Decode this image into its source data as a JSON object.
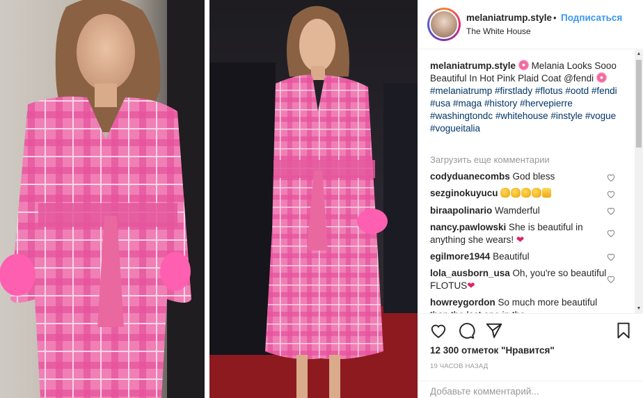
{
  "header": {
    "username": "melaniatrump.style",
    "separator": "•",
    "follow_label": "Подписаться",
    "location": "The White House"
  },
  "caption": {
    "username": "melaniatrump.style",
    "text": " Melania Looks Sooo Beautiful In Hot Pink Plaid Coat @fendi ",
    "hashtags": "#melaniatrump #firstlady #flotus #ootd #fendi #usa #maga #history #hervepierre #washingtondc #whitehouse #instyle #vogue #vogueitalia"
  },
  "load_more_label": "Загрузить еще комментарии",
  "comments": [
    {
      "username": "codyduanecombs",
      "text": " God bless"
    },
    {
      "username": "sezginokuyucu",
      "text": " "
    },
    {
      "username": "biraapolinario",
      "text": " Wamderful"
    },
    {
      "username": "nancy.pawlowski",
      "text": " She is beautiful in anything she wears! ",
      "emoji": "❤"
    },
    {
      "username": "egilmore1944",
      "text": " Beautiful"
    },
    {
      "username": "lola_ausborn_usa",
      "text": " Oh, you're so beautiful FLOTUS",
      "emoji": "❤"
    },
    {
      "username": "howreygordon",
      "text": " So much more beautiful than the last one in the"
    }
  ],
  "likes_text": "12 300 отметок \"Нравится\"",
  "timestamp": "19 ЧАСОВ НАЗАД",
  "add_comment_placeholder": "Добавьте комментарий...",
  "icons": {
    "like": "heart-outline-icon",
    "comment": "speech-bubble-icon",
    "share": "paper-plane-icon",
    "save": "bookmark-icon"
  },
  "colors": {
    "link": "#3897f0",
    "hashtag": "#003569",
    "muted": "#999999"
  }
}
